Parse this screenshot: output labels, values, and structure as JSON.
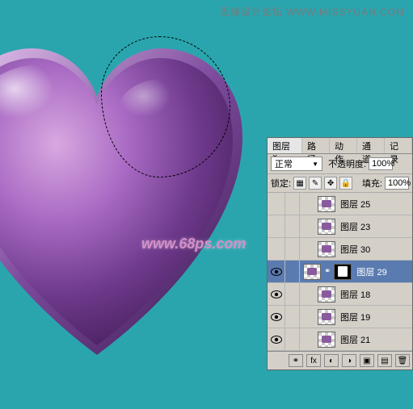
{
  "watermarks": {
    "top": "思缘设计论坛 WWW.MISSYUAN.COM",
    "center": "www.68ps.com"
  },
  "panel": {
    "tabs": {
      "layers": "图层",
      "paths": "路径",
      "actions": "动作",
      "channels": "通道",
      "history": "记录"
    },
    "blend_mode": "正常",
    "opacity_label": "不透明度:",
    "opacity_value": "100%",
    "lock_label": "锁定:",
    "fill_label": "填充:",
    "fill_value": "100%",
    "layers": [
      {
        "name": "图层 25",
        "visible": false,
        "selected": false,
        "mask": false,
        "indent": true
      },
      {
        "name": "图层 23",
        "visible": false,
        "selected": false,
        "mask": false,
        "indent": true
      },
      {
        "name": "图层 30",
        "visible": false,
        "selected": false,
        "mask": false,
        "indent": true
      },
      {
        "name": "图层 29",
        "visible": true,
        "selected": true,
        "mask": true,
        "indent": false
      },
      {
        "name": "图层 18",
        "visible": true,
        "selected": false,
        "mask": false,
        "indent": true
      },
      {
        "name": "图层 19",
        "visible": true,
        "selected": false,
        "mask": false,
        "indent": true
      },
      {
        "name": "图层 21",
        "visible": true,
        "selected": false,
        "mask": false,
        "indent": true
      }
    ],
    "footer_icons": [
      "fx",
      "mask",
      "adjust",
      "group",
      "new",
      "trash"
    ]
  }
}
